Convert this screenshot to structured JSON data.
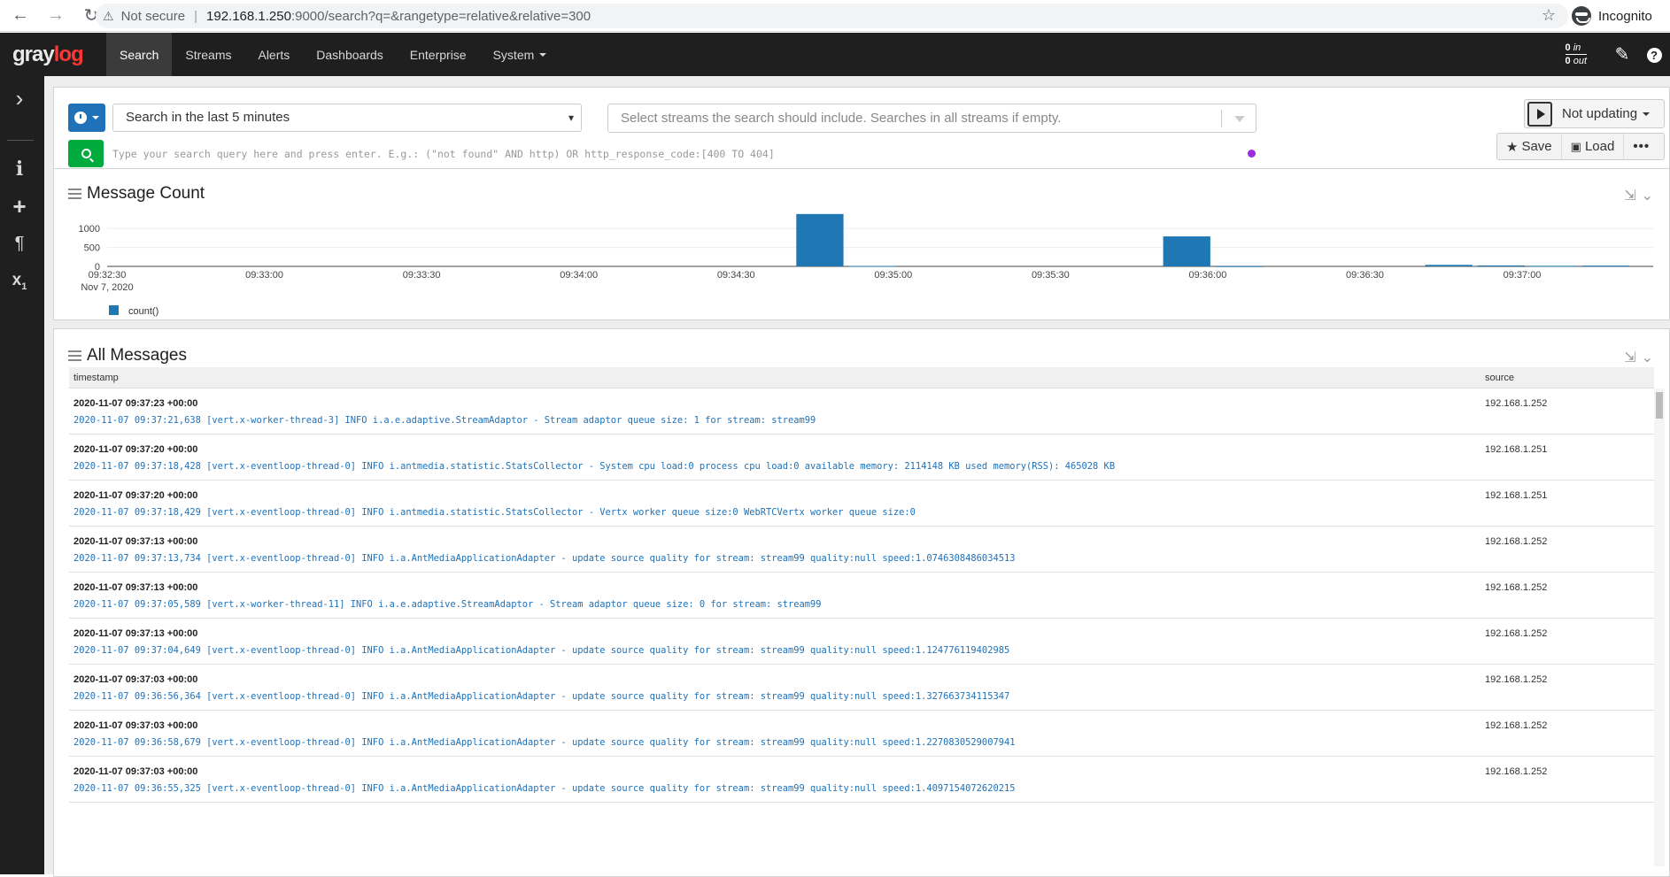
{
  "browser": {
    "security_label": "Not secure",
    "url_host": "192.168.1.250",
    "url_rest": ":9000/search?q=&rangetype=relative&relative=300",
    "profile": "Incognito"
  },
  "nav": {
    "logo_gray": "gray",
    "logo_log": "log",
    "items": [
      "Search",
      "Streams",
      "Alerts",
      "Dashboards",
      "Enterprise",
      "System"
    ],
    "throughput_in": "0",
    "throughput_in_label": "in",
    "throughput_out": "0",
    "throughput_out_label": "out"
  },
  "search": {
    "time_range": "Search in the last 5 minutes",
    "streams_placeholder": "Select streams the search should include. Searches in all streams if empty.",
    "query_placeholder": "Type your search query here and press enter. E.g.: (\"not found\" AND http) OR http_response_code:[400 TO 404]",
    "refresh_label": "Not updating",
    "save_label": "Save",
    "load_label": "Load"
  },
  "message_count": {
    "title": "Message Count",
    "legend": "count()",
    "date_label": "Nov 7, 2020"
  },
  "chart_data": {
    "type": "bar",
    "x": [
      "09:34:46",
      "09:34:56",
      "09:35:56",
      "09:36:06",
      "09:36:46",
      "09:36:56",
      "09:37:06",
      "09:37:16"
    ],
    "series": [
      {
        "name": "count()",
        "values": [
          1380,
          12,
          790,
          6,
          40,
          25,
          15,
          20
        ],
        "color": "#1f77b4"
      }
    ],
    "xticks": [
      "09:32:30",
      "09:33:00",
      "09:33:30",
      "09:34:00",
      "09:34:30",
      "09:35:00",
      "09:35:30",
      "09:36:00",
      "09:36:30",
      "09:37:00"
    ],
    "yticks": [
      "0",
      "500",
      "1000"
    ],
    "xlim": [
      "09:32:30",
      "09:37:25"
    ],
    "ylim": [
      0,
      1400
    ],
    "grid": true,
    "legend": "bottom-left"
  },
  "all_messages": {
    "title": "All Messages",
    "columns": [
      "timestamp",
      "source"
    ],
    "rows": [
      {
        "ts": "2020-11-07 09:37:23 +00:00",
        "msg": "2020-11-07 09:37:21,638 [vert.x-worker-thread-3] INFO i.a.e.adaptive.StreamAdaptor - Stream adaptor queue size: 1 for stream: stream99",
        "src": "192.168.1.252"
      },
      {
        "ts": "2020-11-07 09:37:20 +00:00",
        "msg": "2020-11-07 09:37:18,428 [vert.x-eventloop-thread-0] INFO i.antmedia.statistic.StatsCollector - System cpu load:0 process cpu load:0 available memory: 2114148 KB used memory(RSS): 465028 KB",
        "src": "192.168.1.251"
      },
      {
        "ts": "2020-11-07 09:37:20 +00:00",
        "msg": "2020-11-07 09:37:18,429 [vert.x-eventloop-thread-0] INFO i.antmedia.statistic.StatsCollector - Vertx worker queue size:0 WebRTCVertx worker queue size:0",
        "src": "192.168.1.251"
      },
      {
        "ts": "2020-11-07 09:37:13 +00:00",
        "msg": "2020-11-07 09:37:13,734 [vert.x-eventloop-thread-0] INFO i.a.AntMediaApplicationAdapter - update source quality for stream: stream99 quality:null speed:1.0746308486034513",
        "src": "192.168.1.252"
      },
      {
        "ts": "2020-11-07 09:37:13 +00:00",
        "msg": "2020-11-07 09:37:05,589 [vert.x-worker-thread-11] INFO i.a.e.adaptive.StreamAdaptor - Stream adaptor queue size: 0 for stream: stream99",
        "src": "192.168.1.252"
      },
      {
        "ts": "2020-11-07 09:37:13 +00:00",
        "msg": "2020-11-07 09:37:04,649 [vert.x-eventloop-thread-0] INFO i.a.AntMediaApplicationAdapter - update source quality for stream: stream99 quality:null speed:1.124776119402985",
        "src": "192.168.1.252"
      },
      {
        "ts": "2020-11-07 09:37:03 +00:00",
        "msg": "2020-11-07 09:36:56,364 [vert.x-eventloop-thread-0] INFO i.a.AntMediaApplicationAdapter - update source quality for stream: stream99 quality:null speed:1.327663734115347",
        "src": "192.168.1.252"
      },
      {
        "ts": "2020-11-07 09:37:03 +00:00",
        "msg": "2020-11-07 09:36:58,679 [vert.x-eventloop-thread-0] INFO i.a.AntMediaApplicationAdapter - update source quality for stream: stream99 quality:null speed:1.2270830529007941",
        "src": "192.168.1.252"
      },
      {
        "ts": "2020-11-07 09:37:03 +00:00",
        "msg": "2020-11-07 09:36:55,325 [vert.x-eventloop-thread-0] INFO i.a.AntMediaApplicationAdapter - update source quality for stream: stream99 quality:null speed:1.4097154072620215",
        "src": "192.168.1.252"
      }
    ]
  }
}
